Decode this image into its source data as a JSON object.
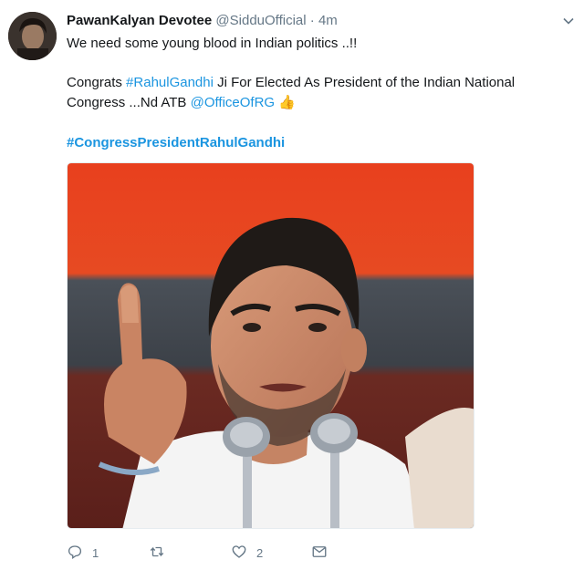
{
  "tweet": {
    "author_name": "PawanKalyan Devotee",
    "author_handle": "@SidduOfficial",
    "separator": "·",
    "time": "4m",
    "line1": "We need some young blood in Indian politics ..!!",
    "line2_prefix": "Congrats ",
    "line2_hashtag": "#RahulGandhi",
    "line2_suffix": " Ji For Elected As President of the Indian National",
    "line3_prefix": "Congress ...Nd ATB ",
    "line3_mention": "@OfficeOfRG",
    "line3_emoji": "👍",
    "hashtag_line": "#CongressPresidentRahulGandhi"
  },
  "actions": {
    "reply_count": "1",
    "retweet_count": "",
    "like_count": "2"
  },
  "icons": {
    "reply": "reply-icon",
    "retweet": "retweet-icon",
    "like": "heart-icon",
    "dm": "envelope-icon",
    "caret": "chevron-down-icon"
  },
  "colors": {
    "link": "#1b95e0",
    "muted": "#657786",
    "text": "#14171a"
  }
}
